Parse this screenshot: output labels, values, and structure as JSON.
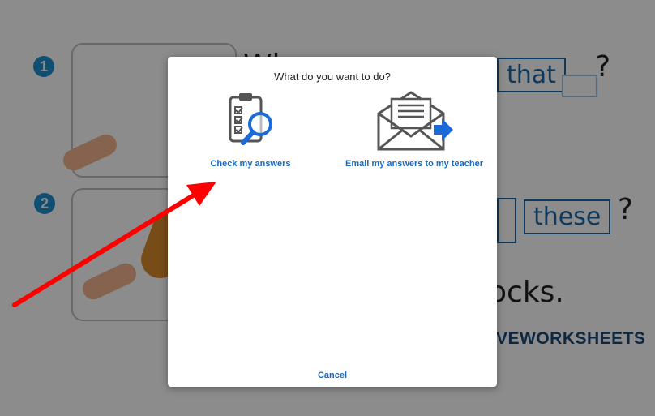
{
  "worksheet": {
    "q1_number": "1",
    "q1_word_start": "Wh",
    "q1_box_word": "that",
    "q1_qmark": "?",
    "q2_number": "2",
    "q2_box_word": "these",
    "q2_qmark": "?",
    "q2_answer_fragment": "ocks.",
    "brand": "VEWORKSHEETS"
  },
  "dialog": {
    "title": "What do you want to do?",
    "options": [
      {
        "label": "Check my answers",
        "icon": "clipboard-magnifier-icon"
      },
      {
        "label": "Email my answers to my teacher",
        "icon": "envelope-send-icon"
      }
    ],
    "cancel_label": "Cancel"
  },
  "annotation": {
    "arrow_color": "#ff0000"
  },
  "colors": {
    "accent": "#1a6bbf",
    "badge": "#1e8fd0",
    "overlay": "rgba(0,0,0,0.45)"
  }
}
